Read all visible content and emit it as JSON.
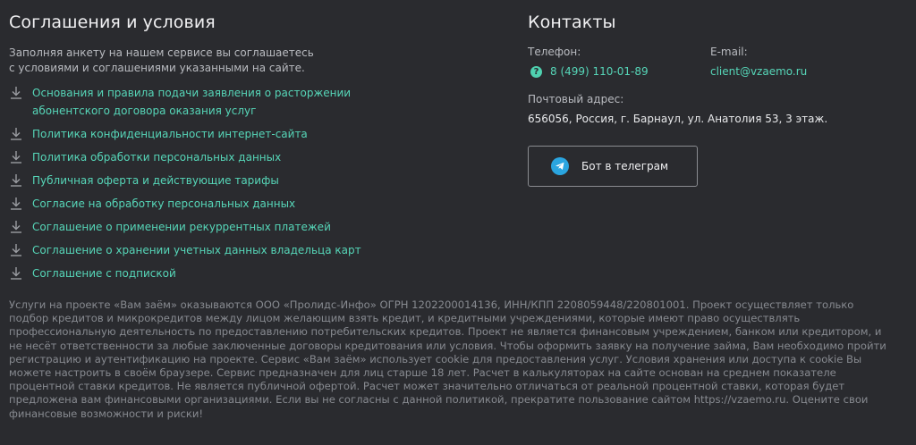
{
  "agreements": {
    "title": "Соглашения и условия",
    "intro_line1": "Заполняя анкету на нашем сервисе вы соглашаетесь",
    "intro_line2": "с условиями и соглашениями указанными на сайте.",
    "docs": [
      {
        "label": "Основания и правила подачи заявления о расторжении абонентского договора оказания услуг"
      },
      {
        "label": "Политика конфиденциальности интернет-сайта"
      },
      {
        "label": "Политика обработки персональных данных"
      },
      {
        "label": "Публичная оферта и действующие тарифы"
      },
      {
        "label": "Согласие на обработку персональных данных"
      },
      {
        "label": "Соглашение о применении рекуррентных платежей"
      },
      {
        "label": "Соглашение о хранении учетных данных владельца карт"
      },
      {
        "label": "Соглашение с подпиской"
      }
    ],
    "doc_icon": "download-icon"
  },
  "contacts": {
    "title": "Контакты",
    "phone_label": "Телефон:",
    "phone": "8 (499) 110-01-89",
    "phone_icon": "help-icon",
    "email_label": "E-mail:",
    "email": "client@vzaemo.ru",
    "address_label": "Почтовый адрес:",
    "address": "656056, Россия, г. Барнаул, ул. Анатолия 53, 3 этаж.",
    "telegram_button": "Бот в телеграм",
    "telegram_icon": "telegram-icon"
  },
  "disclaimer": "Услуги на проекте «Вам заём» оказываются ООО «Пролидс-Инфо» ОГРН 1202200014136, ИНН/КПП 2208059448/220801001. Проект осуществляет только подбор кредитов и микрокредитов между лицом желающим взять кредит, и кредитными учреждениями, которые имеют право осуществлять профессиональную деятельность по предоставлению потребительских кредитов. Проект не является финансовым учреждением, банком или кредитором, и не несёт ответственности за любые заключенные договоры кредитования или условия. Чтобы оформить заявку на получение займа, Вам необходимо пройти регистрацию и аутентификацию на проекте. Сервис «Вам заём» использует cookie для предоставления услуг. Условия хранения или доступа к cookie Вы можете настроить в своём браузере. Сервис предназначен для лиц старше 18 лет. Расчет в калькуляторах на сайте основан на среднем показателе процентной ставки кредитов. Не является публичной офертой. Расчет может значительно отличаться от реальной процентной ставки, которая будет предложена вам финансовыми организациями. Если вы не согласны с данной политикой, прекратите пользование сайтом https://vzaemo.ru. Оцените свои финансовые возможности и риски!",
  "colors": {
    "background": "#2a2b2f",
    "link": "#56d6b8",
    "muted": "#878a90",
    "telegram": "#2aa5e0"
  }
}
